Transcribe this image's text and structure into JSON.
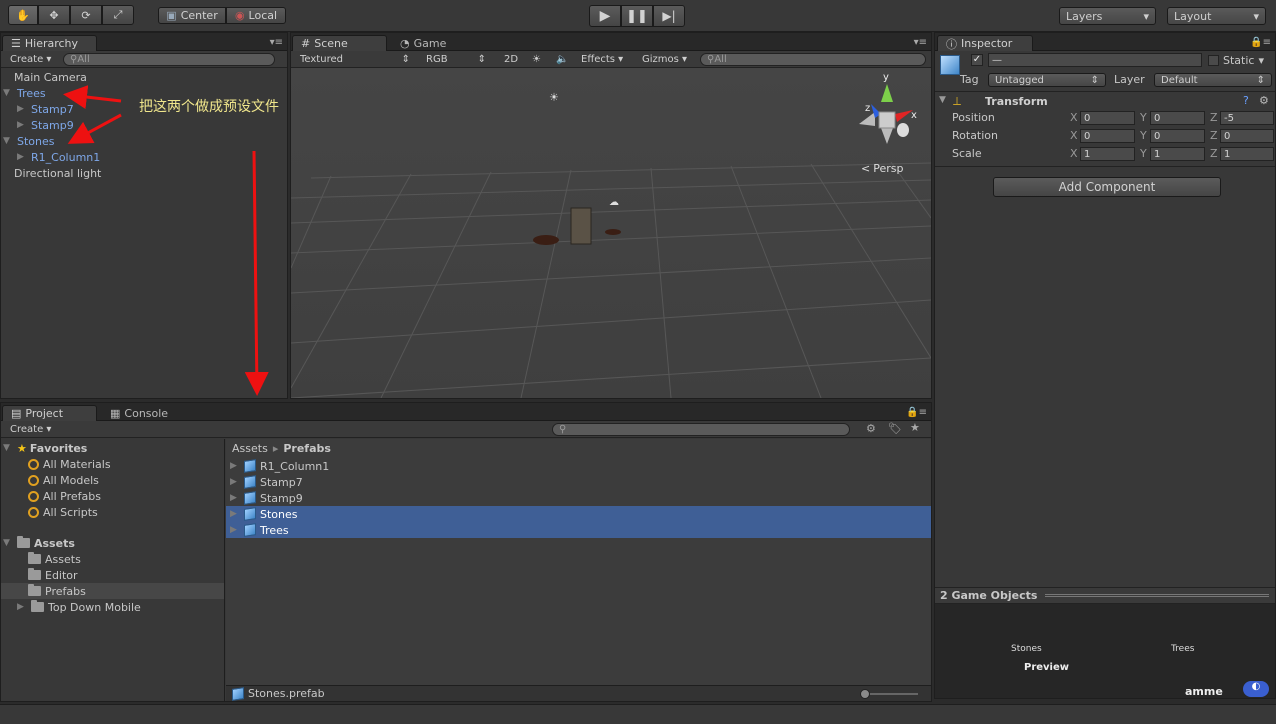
{
  "toolbar": {
    "tools": [
      "hand-tool",
      "move-tool",
      "rotate-tool",
      "scale-tool"
    ],
    "pivot": "Center",
    "space": "Local",
    "layers": "Layers",
    "layout": "Layout"
  },
  "hierarchy": {
    "tab": "Hierarchy",
    "create": "Create",
    "search_placeholder": "All",
    "items": [
      {
        "label": "Main Camera"
      },
      {
        "label": "Trees"
      },
      {
        "label": "Stamp7"
      },
      {
        "label": "Stamp9"
      },
      {
        "label": "Stones"
      },
      {
        "label": "R1_Column1"
      },
      {
        "label": "Directional light"
      }
    ],
    "annotation": "把这两个做成预设文件"
  },
  "scene": {
    "tab_scene": "Scene",
    "tab_game": "Game",
    "shading": "Textured",
    "render": "RGB",
    "mode2d": "2D",
    "effects": "Effects",
    "gizmos": "Gizmos",
    "search_placeholder": "All",
    "axis_y": "y",
    "axis_x": "x",
    "axis_z": "z",
    "persp": "Persp"
  },
  "inspector": {
    "tab": "Inspector",
    "name_value": "—",
    "static": "Static",
    "tag_label": "Tag",
    "tag_value": "Untagged",
    "layer_label": "Layer",
    "layer_value": "Default",
    "transform": "Transform",
    "rows": [
      {
        "label": "Position",
        "x": "0",
        "y": "0",
        "z": "-5"
      },
      {
        "label": "Rotation",
        "x": "0",
        "y": "0",
        "z": "0"
      },
      {
        "label": "Scale",
        "x": "1",
        "y": "1",
        "z": "1"
      }
    ],
    "ax_x": "X",
    "ax_y": "Y",
    "ax_z": "Z",
    "add_component": "Add Component",
    "preview_header": "2 Game Objects",
    "preview_a": "Stones",
    "preview_b": "Trees",
    "preview_label": "Preview",
    "watermark": "amme"
  },
  "project": {
    "tab_project": "Project",
    "tab_console": "Console",
    "create": "Create",
    "favorites": "Favorites",
    "fav_items": [
      "All Materials",
      "All Models",
      "All Prefabs",
      "All Scripts"
    ],
    "assets": "Assets",
    "asset_folders": [
      "Assets",
      "Editor",
      "Prefabs",
      "Top Down Mobile"
    ],
    "breadcrumb_root": "Assets",
    "breadcrumb_sep": "▸",
    "breadcrumb_current": "Prefabs",
    "files": [
      "R1_Column1",
      "Stamp7",
      "Stamp9",
      "Stones",
      "Trees"
    ],
    "status_file": "Stones.prefab"
  }
}
